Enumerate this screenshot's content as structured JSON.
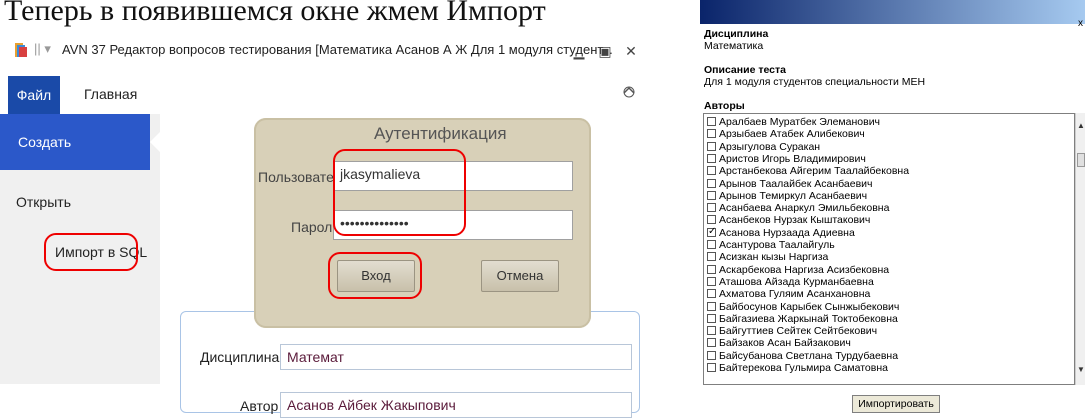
{
  "top_text": "Теперь в появившемся окне жмем Импорт",
  "app": {
    "title": "AVN 37 Редактор вопросов тестирования [Математика Асанов А Ж Для 1 модуля студент...",
    "tabs": {
      "file": "Файл",
      "home": "Главная"
    },
    "nav": {
      "create": "Создать",
      "open": "Открыть",
      "import": "Импорт в SQL"
    },
    "form": {
      "discipline_label": "Дисциплина",
      "discipline_value": "Математ",
      "author_label": "Автор",
      "author_value": "Асанов Айбек Жакыпович"
    }
  },
  "auth_dialog": {
    "title": "Аутентификация",
    "user_label": "Пользователь",
    "user_value": "jkasymalieva",
    "password_label": "Пароль",
    "password_value": "••••••••••••••",
    "login_button": "Вход",
    "cancel_button": "Отмена"
  },
  "import_panel": {
    "close": "x",
    "discipline_label": "Дисциплина",
    "discipline_value": "Математика",
    "desc_label": "Описание теста",
    "desc_value": "Для 1 модуля студентов специальности МЕН",
    "authors_label": "Авторы",
    "authors": [
      {
        "name": "Аралбаев Муратбек Элеманович",
        "checked": false
      },
      {
        "name": "Арзыбаев Атабек Алибекович",
        "checked": false
      },
      {
        "name": "Арзыгулова Суракан",
        "checked": false
      },
      {
        "name": "Аристов Игорь Владимирович",
        "checked": false
      },
      {
        "name": "Арстанбекова Айгерим Таалайбековна",
        "checked": false
      },
      {
        "name": "Арынов Таалайбек Асанбаевич",
        "checked": false
      },
      {
        "name": "Арынов Темиркул Асанбаевич",
        "checked": false
      },
      {
        "name": "Асанбаева Анаркул Эмильбековна",
        "checked": false
      },
      {
        "name": "Асанбеков Нурзак Кыштакович",
        "checked": false
      },
      {
        "name": "Асанова Нурзаада Адиевна",
        "checked": true
      },
      {
        "name": "Асантурова Таалайгуль",
        "checked": false
      },
      {
        "name": "Асизкан кызы Наргиза",
        "checked": false
      },
      {
        "name": "Аскарбекова Наргиза Асизбековна",
        "checked": false
      },
      {
        "name": "Аташова Айзада Курманбаевна",
        "checked": false
      },
      {
        "name": "Ахматова Гуляим Асанхановна",
        "checked": false
      },
      {
        "name": "Байбосунов Карыбек Сынжыбекович",
        "checked": false
      },
      {
        "name": "Байгазиева Жаркынай Токтобековна",
        "checked": false
      },
      {
        "name": "Байгуттиев Сейтек Сейтбекович",
        "checked": false
      },
      {
        "name": "Байзаков Асан Байзакович",
        "checked": false
      },
      {
        "name": "Байсубанова Светлана Турдубаевна",
        "checked": false
      },
      {
        "name": "Байтерекова Гульмира Саматовна",
        "checked": false
      }
    ],
    "import_button": "Импортировать"
  }
}
